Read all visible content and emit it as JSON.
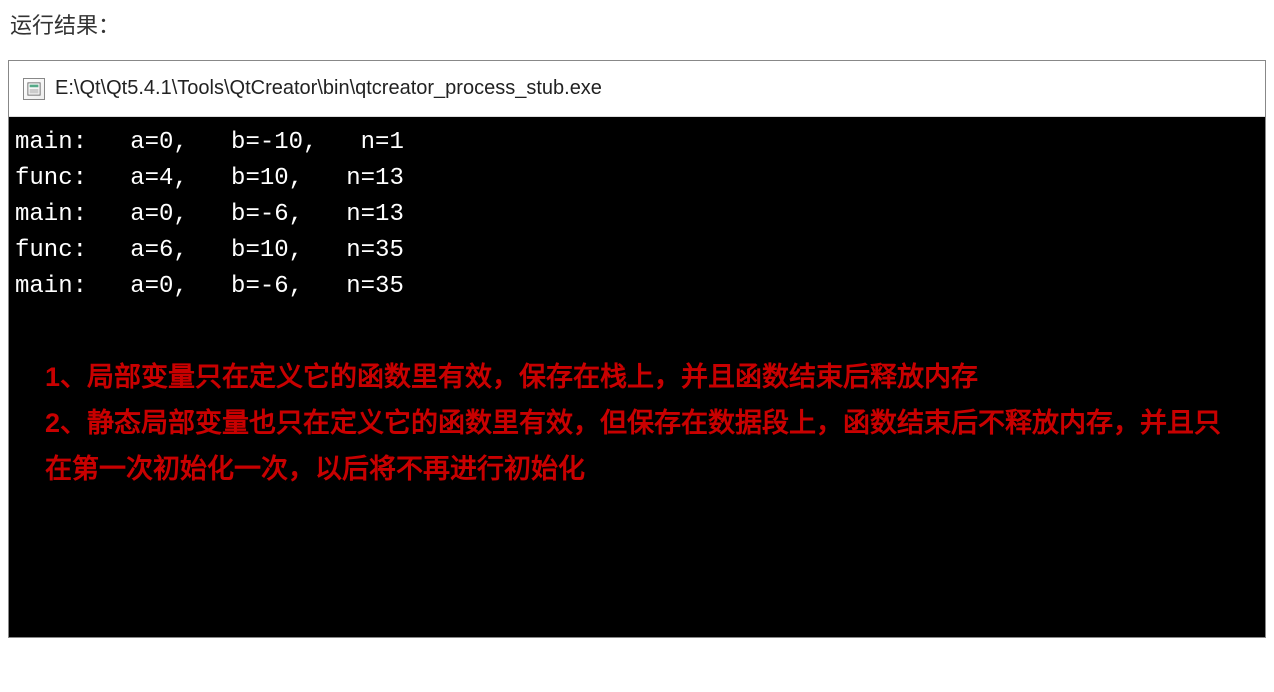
{
  "heading": "运行结果：",
  "titleBar": {
    "path": "E:\\Qt\\Qt5.4.1\\Tools\\QtCreator\\bin\\qtcreator_process_stub.exe"
  },
  "console": {
    "lines": [
      "main:   a=0,   b=-10,   n=1",
      "func:   a=4,   b=10,   n=13",
      "main:   a=0,   b=-6,   n=13",
      "func:   a=6,   b=10,   n=35",
      "main:   a=0,   b=-6,   n=35"
    ]
  },
  "annotations": {
    "line1": "1、局部变量只在定义它的函数里有效，保存在栈上，并且函数结束后释放内存",
    "line2": "2、静态局部变量也只在定义它的函数里有效，但保存在数据段上，函数结束后不释放内存，并且只在第一次初始化一次，以后将不再进行初始化"
  }
}
